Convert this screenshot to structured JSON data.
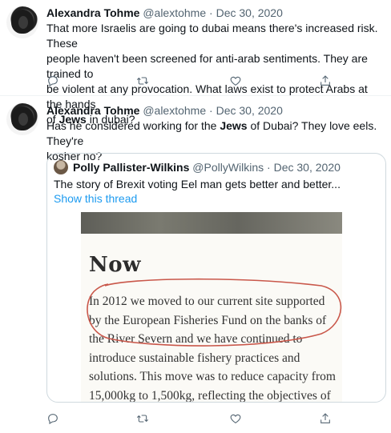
{
  "tweets": [
    {
      "author": "Alexandra Tohme",
      "handle": "@alextohme",
      "separator": "·",
      "date": "Dec 30, 2020",
      "text_parts": {
        "line1": "That more Israelis are going to dubai means there's increased risk. These",
        "line2": "people haven't been screened for anti-arab sentiments. They are trained to",
        "line3": "be violent at any provocation. What laws exist to protect Arabs at the hands",
        "line4_pre": "of ",
        "line4_bold": "Jews",
        "line4_post": " in dubai?"
      }
    },
    {
      "author": "Alexandra Tohme",
      "handle": "@alextohme",
      "separator": "·",
      "date": "Dec 30, 2020",
      "text_parts": {
        "line1_pre": "Has he considered working for the ",
        "line1_bold": "Jews",
        "line1_post": " of Dubai? They love eels. They're",
        "line2": "kosher no?"
      },
      "quote": {
        "author": "Polly Pallister-Wilkins",
        "handle": "@PollyWilkins",
        "separator": "·",
        "date": "Dec 30, 2020",
        "text": "The story of Brexit voting Eel man gets better and better...",
        "link": "Show this thread",
        "image": {
          "title": "Now",
          "lines": [
            "In 2012 we moved to our current site supported",
            "by the European Fisheries Fund on the banks of",
            "the River Severn and we have continued to",
            "introduce sustainable fishery practices and",
            "solutions. This move was to reduce capacity from",
            "15,000kg to 1,500kg, reflecting the objectives of"
          ],
          "annotation_color": "#c9574a"
        }
      }
    }
  ],
  "icons": [
    "reply-icon",
    "retweet-icon",
    "like-icon",
    "share-icon"
  ],
  "colors": {
    "link": "#1d9bf0",
    "muted": "#536471",
    "border": "#cfd9de"
  }
}
